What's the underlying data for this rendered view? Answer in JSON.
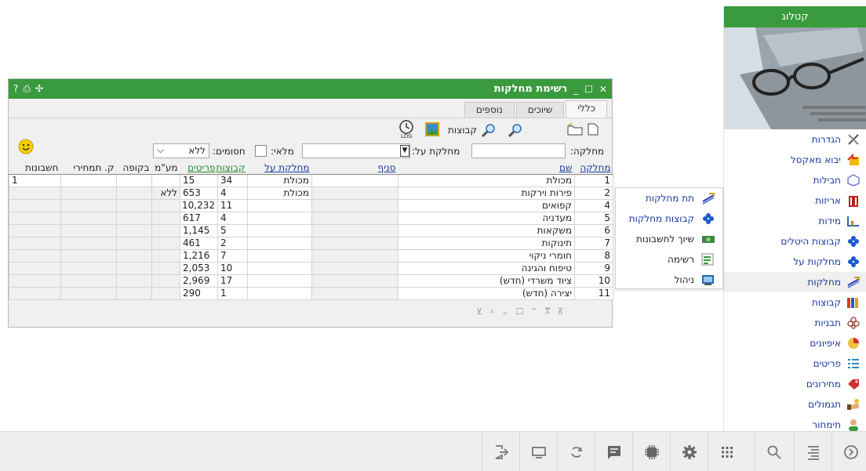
{
  "sidebar": {
    "title": "קטלוג",
    "items": [
      {
        "label": "הגדרות",
        "icon": "tools-icon"
      },
      {
        "label": "יבוא מאקסל",
        "icon": "import-icon"
      },
      {
        "label": "חבילות",
        "icon": "package-icon"
      },
      {
        "label": "אריזות",
        "icon": "box-icon"
      },
      {
        "label": "מידות",
        "icon": "ruler-icon"
      },
      {
        "label": "קבוצות היטלים",
        "icon": "diamond-icon"
      },
      {
        "label": "מחלקות על",
        "icon": "diamond-icon"
      },
      {
        "label": "מחלקות",
        "icon": "departments-icon"
      },
      {
        "label": "קבוצות",
        "icon": "books-icon"
      },
      {
        "label": "תבניות",
        "icon": "flower-icon"
      },
      {
        "label": "איפיונים",
        "icon": "chart-icon"
      },
      {
        "label": "פריטים",
        "icon": "list-icon"
      },
      {
        "label": "מחירונים",
        "icon": "tag-icon"
      },
      {
        "label": "תגמולים",
        "icon": "hand-icon"
      },
      {
        "label": "תימחור",
        "icon": "person-icon"
      }
    ]
  },
  "flyout": {
    "items": [
      {
        "label": "תת מחלקות"
      },
      {
        "label": "קבוצות מחלקות"
      },
      {
        "label": "שיוך לחשבונות"
      },
      {
        "label": "רשימה"
      },
      {
        "label": "ניהול"
      }
    ]
  },
  "window": {
    "title": "רשימת מחלקות",
    "tabs": [
      "כללי",
      "שיוכים",
      "נוספים"
    ],
    "toolbar": {
      "groups_label": "קבוצות"
    },
    "filters": {
      "department_label": "מחלקה:",
      "super_department_label": "מחלקת על:",
      "full_label": "מלאי:",
      "blocked_label": "חסומים:",
      "blocked_value": "ללא"
    },
    "columns": [
      "מחלקה",
      "שם",
      "סניף",
      "מחלקת על",
      "קבוצות",
      "פריטים",
      "מע\"מ",
      "בקופה",
      "ק. תמחירי",
      "חשבונות"
    ],
    "rows": [
      {
        "dept": "1",
        "name": "מכולת",
        "branch": "",
        "super": "מכולת",
        "groups": "34",
        "items": "15",
        "vat": "",
        "register": "",
        "pricing": "",
        "accounts": "1"
      },
      {
        "dept": "2",
        "name": "פירות וירקות",
        "branch": "",
        "super": "מכולת",
        "groups": "4",
        "items": "653",
        "vat": "ללא",
        "register": "",
        "pricing": "",
        "accounts": ""
      },
      {
        "dept": "4",
        "name": "קפואים",
        "branch": "",
        "super": "",
        "groups": "11",
        "items": "10,232",
        "vat": "",
        "register": "",
        "pricing": "",
        "accounts": ""
      },
      {
        "dept": "5",
        "name": "מעדניה",
        "branch": "",
        "super": "",
        "groups": "4",
        "items": "617",
        "vat": "",
        "register": "",
        "pricing": "",
        "accounts": ""
      },
      {
        "dept": "6",
        "name": "משקאות",
        "branch": "",
        "super": "",
        "groups": "5",
        "items": "1,145",
        "vat": "",
        "register": "",
        "pricing": "",
        "accounts": ""
      },
      {
        "dept": "7",
        "name": "תינוקות",
        "branch": "",
        "super": "",
        "groups": "2",
        "items": "461",
        "vat": "",
        "register": "",
        "pricing": "",
        "accounts": ""
      },
      {
        "dept": "8",
        "name": "חומרי ניקוי",
        "branch": "",
        "super": "",
        "groups": "7",
        "items": "1,216",
        "vat": "",
        "register": "",
        "pricing": "",
        "accounts": ""
      },
      {
        "dept": "9",
        "name": "טיפוח והגינה",
        "branch": "",
        "super": "",
        "groups": "10",
        "items": "2,053",
        "vat": "",
        "register": "",
        "pricing": "",
        "accounts": ""
      },
      {
        "dept": "10",
        "name": "ציוד משרדי (חדש)",
        "branch": "",
        "super": "",
        "groups": "17",
        "items": "2,969",
        "vat": "",
        "register": "",
        "pricing": "",
        "accounts": ""
      },
      {
        "dept": "11",
        "name": "יצירה (חדש)",
        "branch": "",
        "super": "",
        "groups": "1",
        "items": "290",
        "vat": "",
        "register": "",
        "pricing": "",
        "accounts": ""
      }
    ]
  },
  "colors": {
    "accent": "#3a9a3e",
    "link": "#1a3a9a"
  }
}
